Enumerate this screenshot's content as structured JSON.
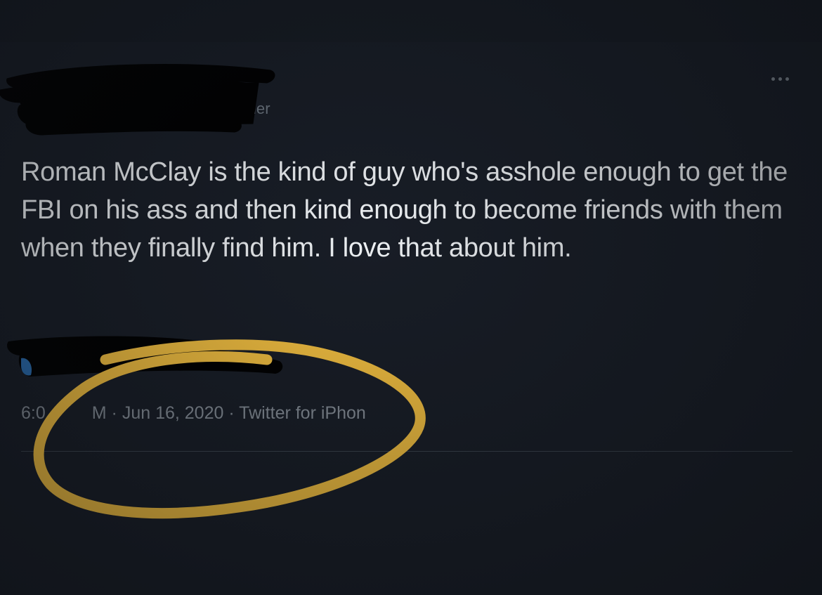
{
  "tweet": {
    "author_name_visible": "nner",
    "text": "Roman McClay is the kind of guy who's asshole enough to get the FBI on his ass and then kind enough to become friends with them when they finally find him. I love that about him.",
    "time_prefix": "6:0",
    "time_suffix": "M",
    "date": "· Jun 16, 2020 ·",
    "source": "Twitter for iPhon",
    "more_icon": "more-horizontal-icon"
  },
  "colors": {
    "background": "#181d26",
    "text": "#eef1f4",
    "muted": "#858d96",
    "highlight_circle": "#f4c040",
    "redaction": "#000000"
  }
}
